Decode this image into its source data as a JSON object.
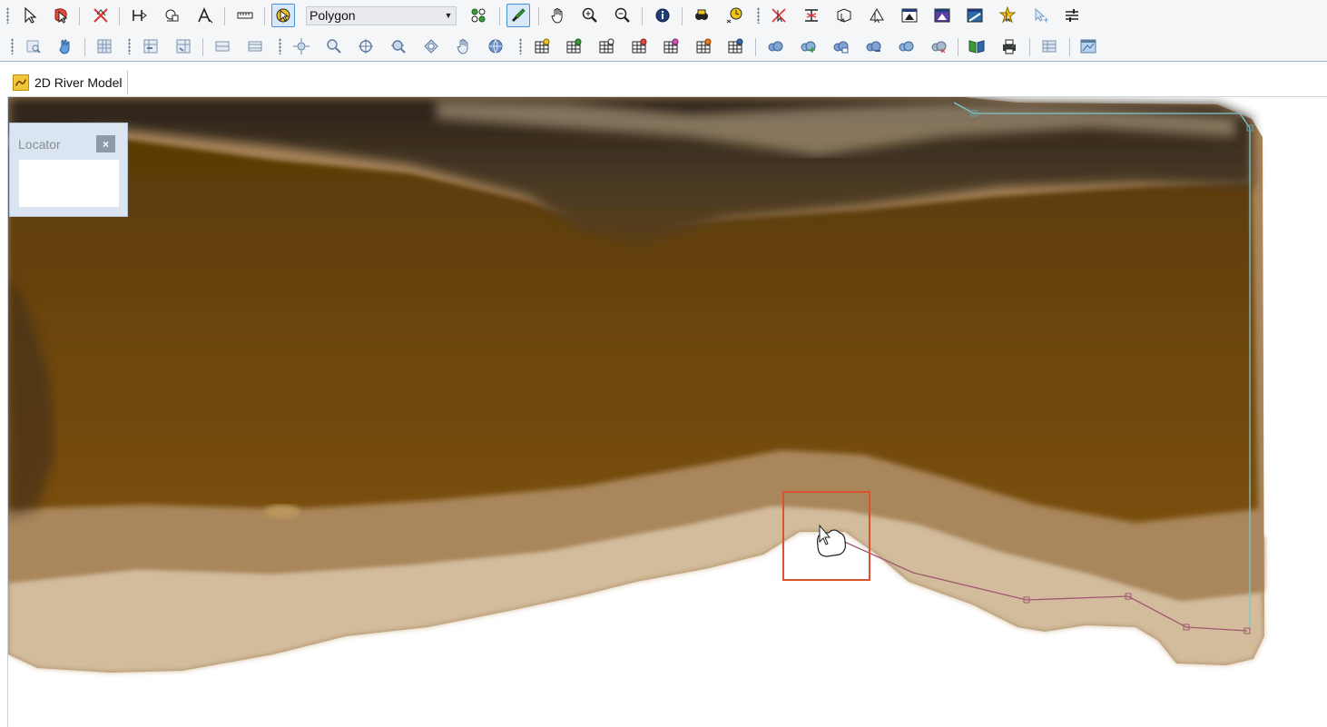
{
  "toolbar": {
    "row1_icons": [
      "select-arrow-icon",
      "select-features-icon",
      "delete-features-icon",
      "edit-vertices-icon",
      "merge-features-icon",
      "annotate-icon",
      "measure-ruler-icon",
      "create-feature-icon",
      "feature-type-combo",
      "snap-icon",
      "edit-brush-icon",
      "pan-hand-icon",
      "zoom-in-icon",
      "zoom-out-icon",
      "identify-icon",
      "find-icon",
      "time-icon",
      "split-arrow-icon",
      "reshape-icon",
      "transform-icon",
      "move-vertex-icon",
      "layer-window-1-icon",
      "layer-window-2-icon",
      "layer-window-3-icon",
      "highlight-icon",
      "pointer-plus-icon",
      "settings-icon"
    ],
    "row2_icons": [
      "search-table-icon",
      "hand-select-icon",
      "table-icon",
      "grid-left-icon",
      "grid-right-icon",
      "pan-left-icon",
      "pan-right-icon",
      "full-extent-icon",
      "zoom-in-2-icon",
      "center-icon",
      "zoom-to-layer-icon",
      "zoom-to-selection-icon",
      "pan-2-icon",
      "globe-icon",
      "layer-1-icon",
      "layer-2-icon",
      "layer-3-icon",
      "layer-4-icon",
      "layer-5-icon",
      "layer-6-icon",
      "layer-7-icon",
      "cloud-1-icon",
      "cloud-2-icon",
      "cloud-3-icon",
      "cloud-4-icon",
      "cloud-5-icon",
      "cloud-6-icon",
      "map-book-icon",
      "print-icon",
      "export-table-icon",
      "map-window-icon"
    ],
    "feature_type": "Polygon"
  },
  "tab": {
    "label": "2D River Model"
  },
  "locator": {
    "title": "Locator",
    "close": "×"
  },
  "colors": {
    "water": "#6b4509",
    "water_dark": "#4e3306",
    "bank": "#b49066",
    "bank_light": "#d8c3a6",
    "ridge": "#2b2218",
    "boundary_line": "#7fc6cf",
    "polyline": "#a05870",
    "highlight": "#d9532e"
  }
}
